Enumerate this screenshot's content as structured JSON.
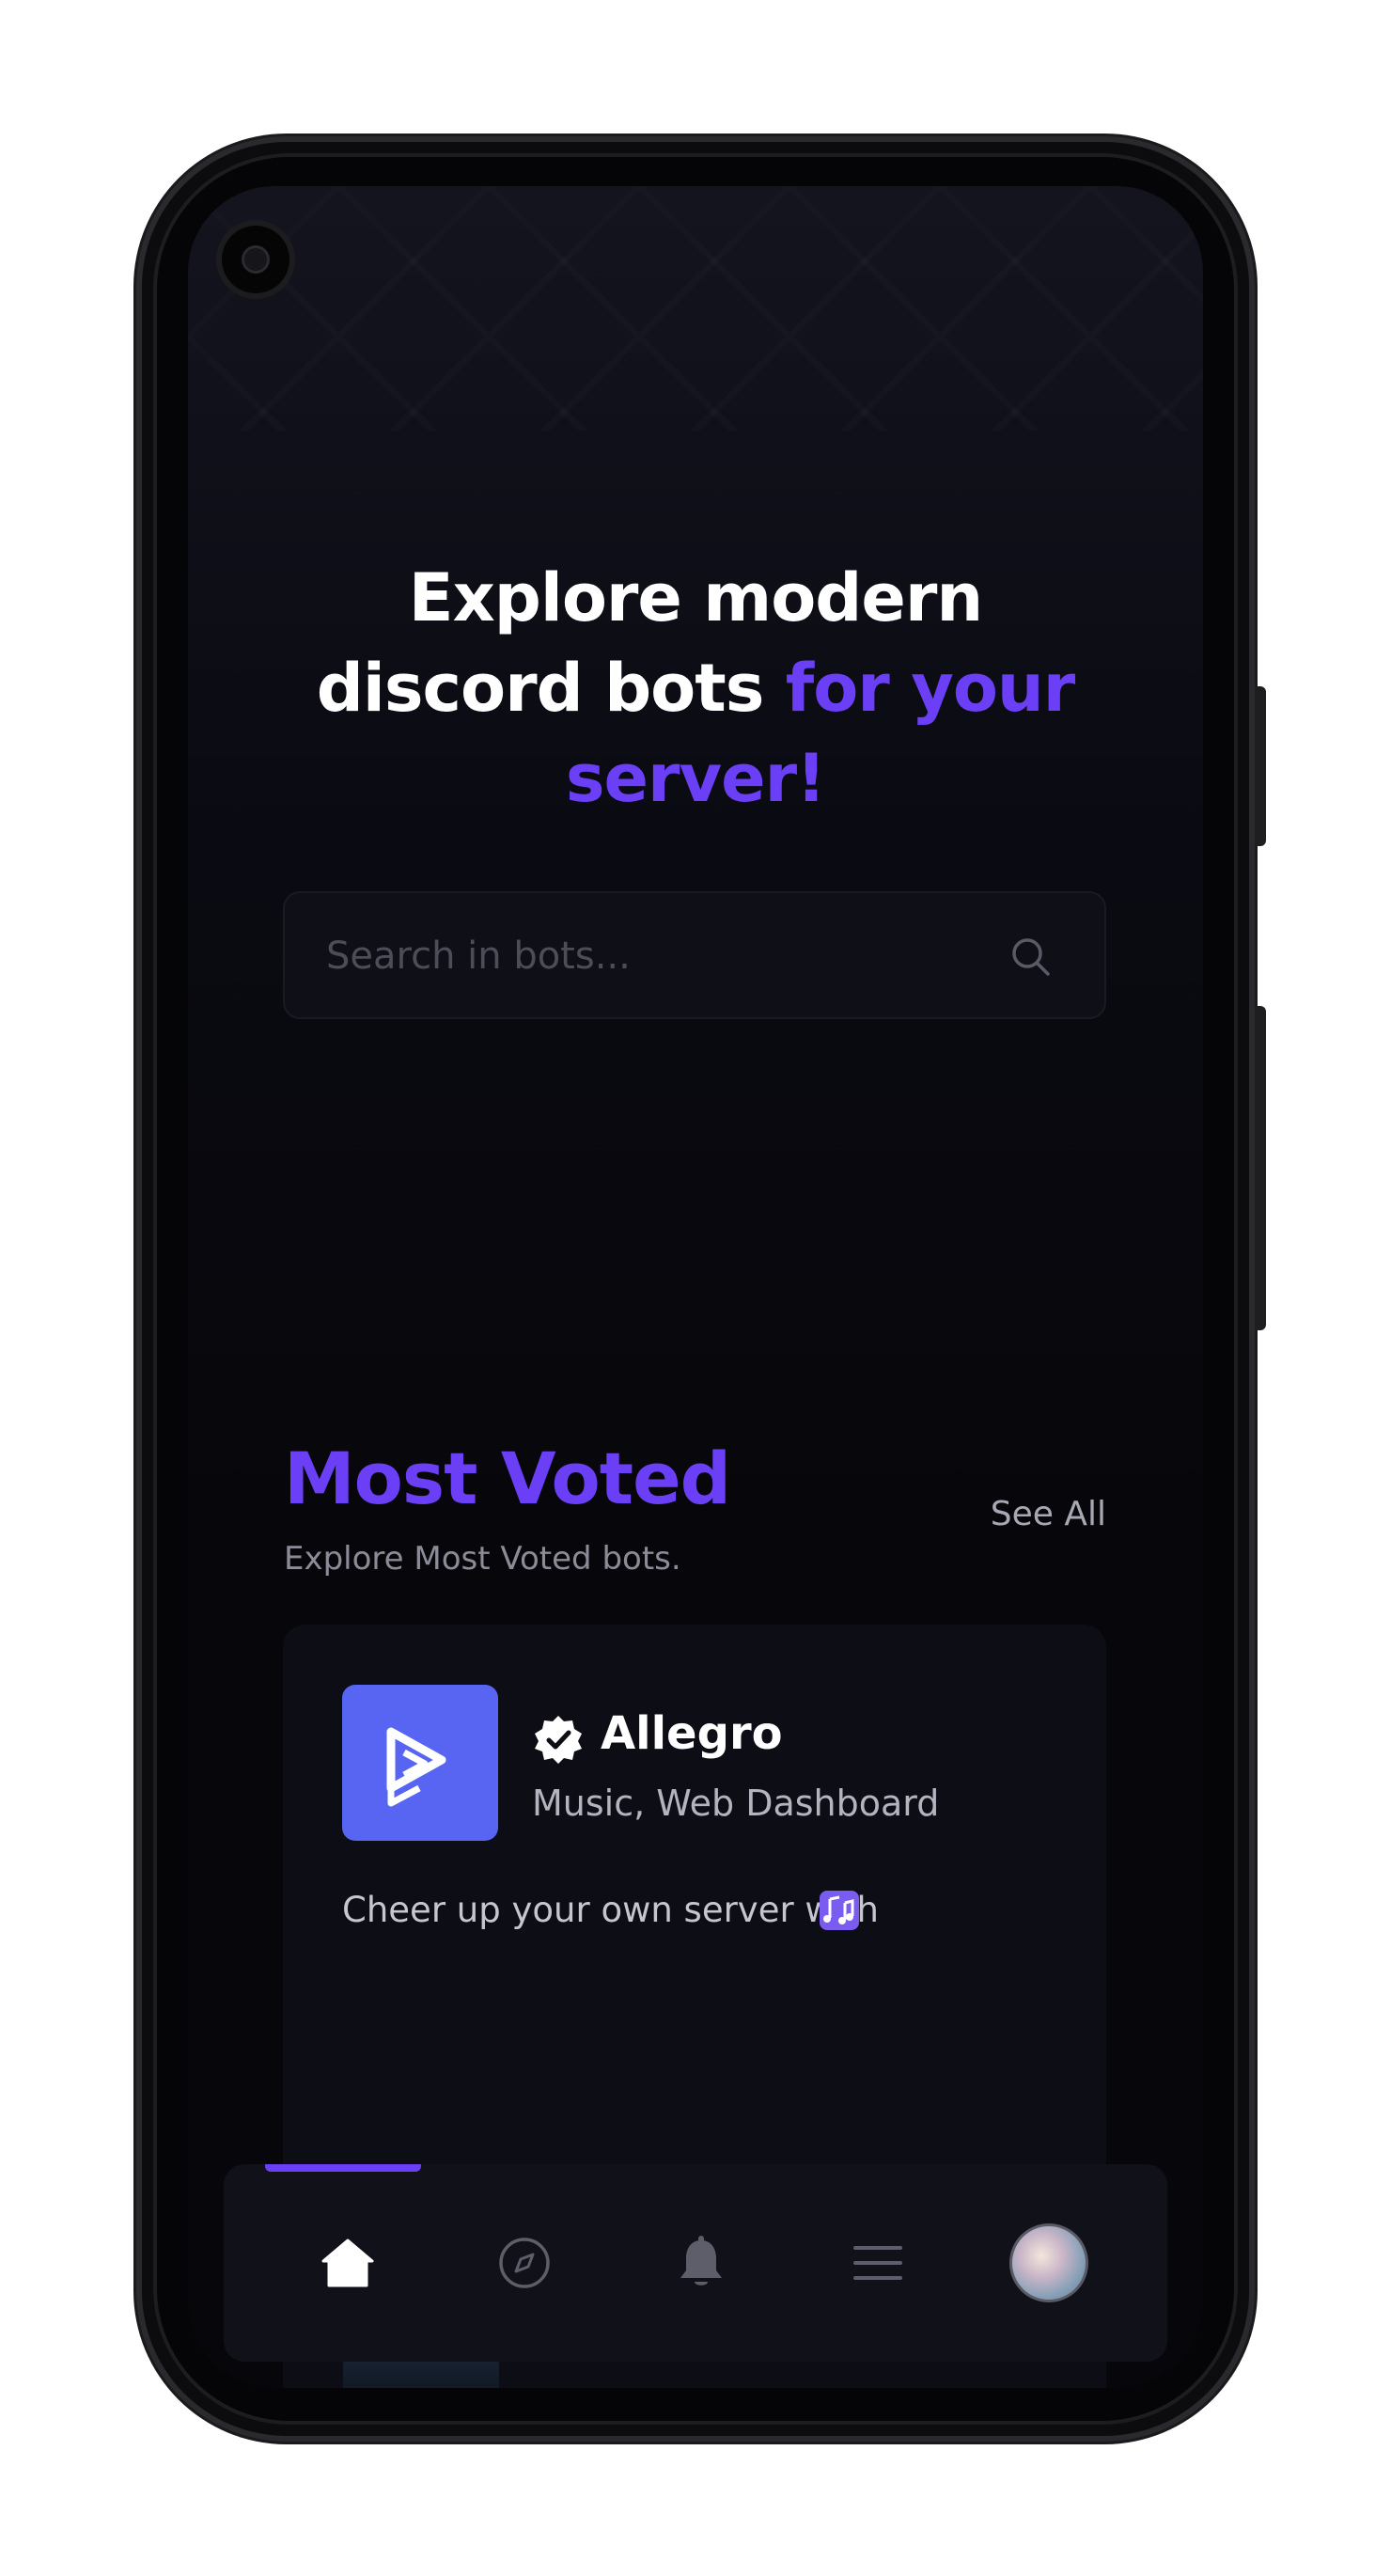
{
  "hero": {
    "line1": "Explore modern",
    "line2_white": "discord bots ",
    "line2_accent": "for your",
    "line3_accent": "server!"
  },
  "search": {
    "placeholder": "Search in bots..."
  },
  "most_voted": {
    "title": "Most Voted",
    "subtitle": "Explore Most Voted bots.",
    "see_all": "See All"
  },
  "bot_card": {
    "name": "Allegro",
    "tags": "Music, Web Dashboard",
    "description": "Cheer up your own server with",
    "verified": true
  },
  "tabbar": {
    "items": [
      {
        "icon": "home-icon",
        "active": true
      },
      {
        "icon": "compass-icon",
        "active": false
      },
      {
        "icon": "bell-icon",
        "active": false
      },
      {
        "icon": "menu-icon",
        "active": false
      },
      {
        "icon": "profile-avatar",
        "active": false
      }
    ]
  },
  "colors": {
    "accent": "#6a3ff5",
    "background": "#07070b",
    "card": "#0d0d15",
    "bot_avatar": "#5865f2"
  }
}
